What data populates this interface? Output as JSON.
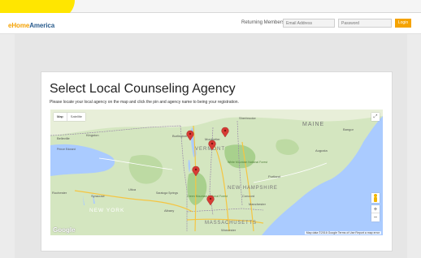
{
  "brand": {
    "part1": "eHome",
    "part2": "America",
    "highlight_color": "#ffe600"
  },
  "login": {
    "label": "Returning Members:",
    "email_placeholder": "Email Address",
    "password_placeholder": "Password",
    "button": "Login",
    "accent_color": "#f5a300"
  },
  "page": {
    "title": "Select Local Counseling Agency",
    "subtitle": "Please locate your local agency on the map and click the pin and agency name to being your registration."
  },
  "map": {
    "tabs": [
      "Map",
      "Satellite"
    ],
    "provider": "Google",
    "attribution": "Map data ©2016 Google   Terms of Use   Report a map error",
    "pins_count": 5,
    "pin_color": "#d73b35",
    "icons": [
      "fullscreen-icon",
      "pegman-icon",
      "zoom-in-icon",
      "zoom-out-icon",
      "map-pin-icon"
    ],
    "labels": {
      "maine": "MAINE",
      "vermont": "VERMONT",
      "new_hampshire": "NEW HAMPSHIRE",
      "new_york": "NEW YORK",
      "massachusetts": "MASSACHUSETTS",
      "white_mountain": "White Mountain National Forest",
      "green_mountain": "Green Mountain National Forest",
      "kingston": "Kingston",
      "belleville": "Belleville",
      "prince_edward": "Prince Edward",
      "rochester": "Rochester",
      "syracuse": "Syracuse",
      "albany": "Albany",
      "burlington": "Burlington",
      "montpelier": "Montpelier",
      "manchester": "Manchester",
      "worcester": "Worcester",
      "portland": "Portland",
      "sherbrooke": "Sherbrooke",
      "bangor": "Bangor",
      "augusta": "Augusta",
      "concord": "Concord",
      "utica": "Utica",
      "saratoga_springs": "Saratoga Springs"
    }
  }
}
